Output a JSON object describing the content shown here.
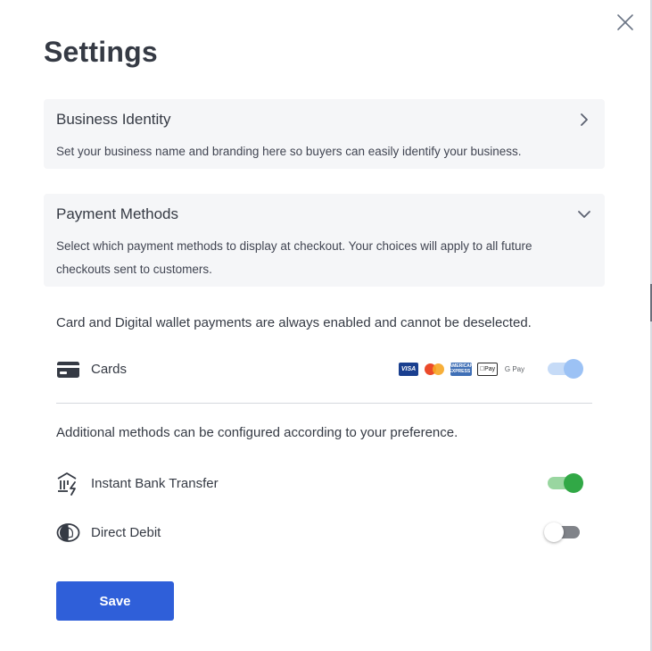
{
  "page": {
    "title": "Settings"
  },
  "sections": {
    "business_identity": {
      "title": "Business Identity",
      "description": "Set your business name and branding here so buyers can easily identify your business.",
      "expanded": false
    },
    "payment_methods": {
      "title": "Payment Methods",
      "description": "Select which payment methods to display at checkout. Your choices will apply to all future checkouts sent to customers.",
      "expanded": true
    }
  },
  "notes": {
    "always_enabled": "Card and Digital wallet payments are always enabled and cannot be deselected.",
    "additional": "Additional methods can be configured according to your preference."
  },
  "methods": {
    "cards": {
      "label": "Cards",
      "icon": "card-icon",
      "enabled": true,
      "locked": true,
      "brands": [
        "VISA",
        "Mastercard",
        "AMERICAN EXPRESS",
        "Apple Pay",
        "G Pay"
      ]
    },
    "bank": {
      "label": "Instant Bank Transfer",
      "icon": "bank-transfer-icon",
      "enabled": true
    },
    "debit": {
      "label": "Direct Debit",
      "icon": "direct-debit-icon",
      "enabled": false
    }
  },
  "brand_text": {
    "visa": "VISA",
    "amex": "AMERICAN EXPRESS",
    "apay": "Pay",
    "gpay": "G Pay"
  },
  "actions": {
    "save_label": "Save"
  },
  "colors": {
    "primary": "#2f5fd9",
    "toggle_on": "#31a846",
    "toggle_locked": "#9cc2f5",
    "card_bg": "#f5f6f8"
  }
}
